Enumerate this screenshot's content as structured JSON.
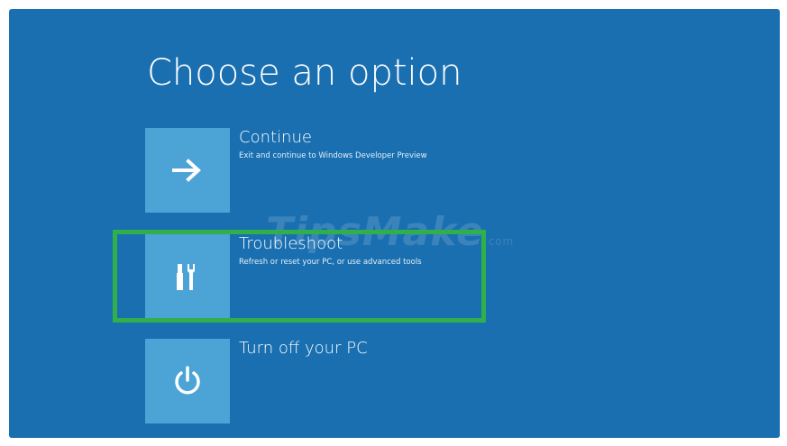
{
  "page": {
    "title": "Choose an option"
  },
  "options": [
    {
      "label": "Continue",
      "description": "Exit and continue to Windows Developer Preview",
      "icon": "arrow-right-icon"
    },
    {
      "label": "Troubleshoot",
      "description": "Refresh or reset your PC, or use advanced tools",
      "icon": "tools-icon"
    },
    {
      "label": "Turn off your PC",
      "description": "",
      "icon": "power-icon"
    }
  ],
  "watermark": {
    "text": "TipsMake",
    "suffix": ".com"
  },
  "colors": {
    "background": "#1a6fb0",
    "tile": "#4ba3d6",
    "highlight": "#2fb04a"
  }
}
